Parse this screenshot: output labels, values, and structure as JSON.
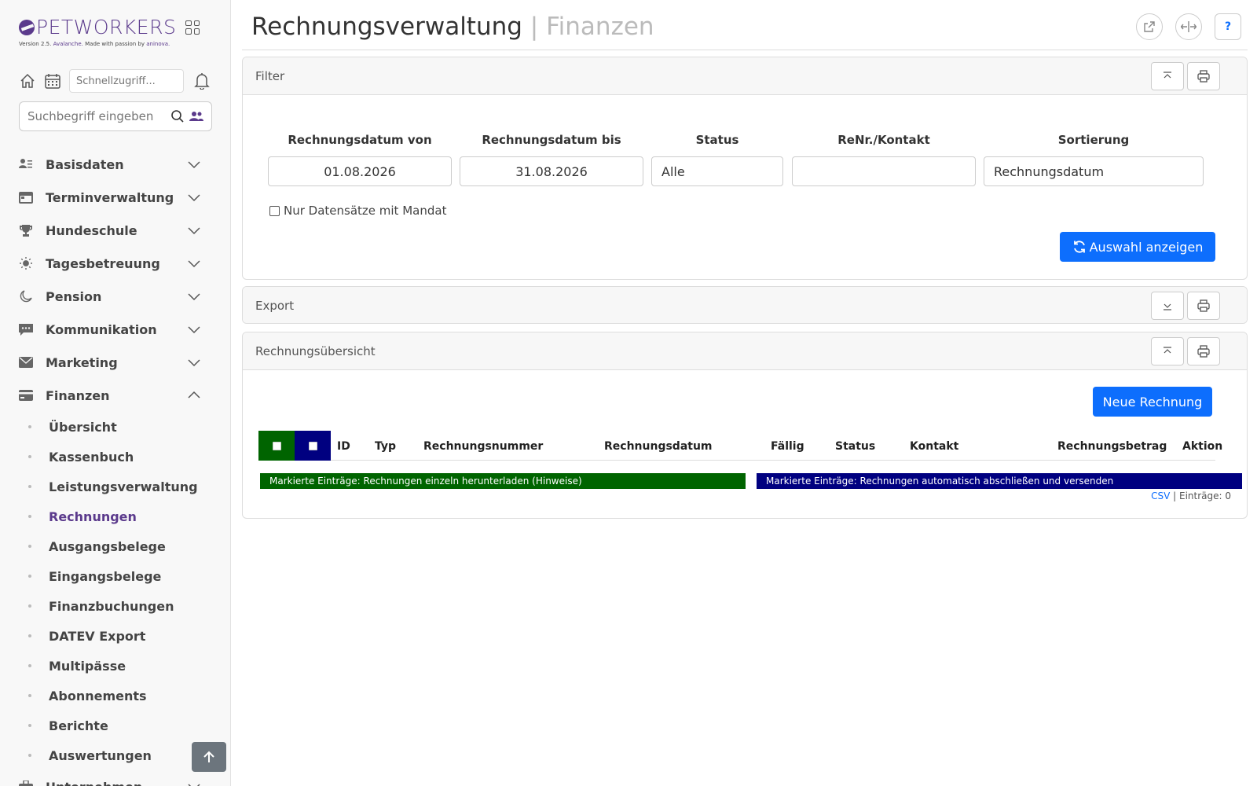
{
  "brand": {
    "name": "PETWORKERS",
    "version_prefix": "Version 2.5.",
    "version_name": "Avalanche.",
    "made_by": "Made with passion by",
    "company": "aninova."
  },
  "toolbar": {
    "quick_access_placeholder": "Schnellzugriff...",
    "search_placeholder": "Suchbegriff eingeben"
  },
  "sidebar": {
    "items": [
      {
        "label": "Basisdaten",
        "icon": "person-list-icon"
      },
      {
        "label": "Terminverwaltung",
        "icon": "calendar-card-icon"
      },
      {
        "label": "Hundeschule",
        "icon": "trophy-icon"
      },
      {
        "label": "Tagesbetreuung",
        "icon": "sun-icon"
      },
      {
        "label": "Pension",
        "icon": "moon-icon"
      },
      {
        "label": "Kommunikation",
        "icon": "chat-icon"
      },
      {
        "label": "Marketing",
        "icon": "envelope-icon"
      },
      {
        "label": "Finanzen",
        "icon": "credit-card-icon"
      }
    ],
    "finance_sub": [
      "Übersicht",
      "Kassenbuch",
      "Leistungsverwaltung",
      "Rechnungen",
      "Ausgangsbelege",
      "Eingangsbelege",
      "Finanzbuchungen",
      "DATEV Export",
      "Multipässe",
      "Abonnements",
      "Berichte",
      "Auswertungen"
    ],
    "active_sub": "Rechnungen",
    "next_item": "Unternehmen"
  },
  "page": {
    "title": "Rechnungsverwaltung",
    "section": "| Finanzen",
    "help": "?"
  },
  "filter": {
    "title": "Filter",
    "date_from_label": "Rechnungsdatum von",
    "date_from": "01.08.2026",
    "date_to_label": "Rechnungsdatum bis",
    "date_to": "31.08.2026",
    "status_label": "Status",
    "status": "Alle",
    "contact_label": "ReNr./Kontakt",
    "contact": "",
    "sort_label": "Sortierung",
    "sort": "Rechnungsdatum",
    "mandate_label": "Nur Datensätze mit Mandat",
    "apply_label": "Auswahl anzeigen"
  },
  "export": {
    "title": "Export"
  },
  "overview": {
    "title": "Rechnungsübersicht",
    "new_label": "Neue Rechnung",
    "columns": [
      "ID",
      "Typ",
      "Rechnungsnummer",
      "Rechnungsdatum",
      "Fällig",
      "Status",
      "Kontakt",
      "Rechnungsbetrag",
      "Aktion"
    ],
    "bulk_download": "Markierte Einträge: Rechnungen einzeln herunterladen (Hinweise)",
    "bulk_send": "Markierte Einträge: Rechnungen automatisch abschließen und versenden",
    "csv": "CSV",
    "entries": "| Einträge: 0"
  },
  "colors": {
    "brand": "#5b3a8c",
    "primary": "#0d6efd",
    "green": "#006400",
    "navy": "#000080"
  }
}
